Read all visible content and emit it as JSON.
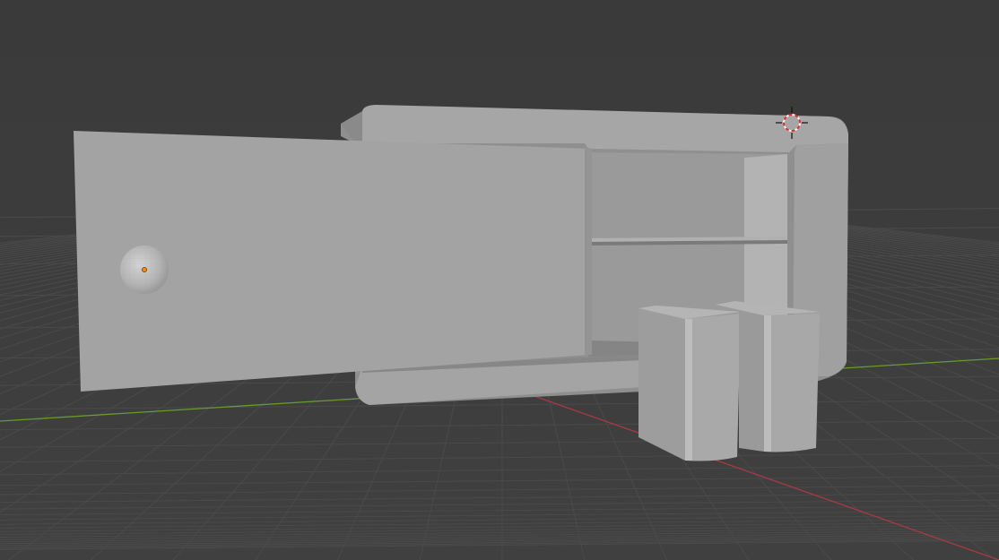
{
  "viewport": {
    "background_color": "#3d3d3d",
    "grid_color": "#4a4a4a",
    "x_axis_color": "#a83a44",
    "y_axis_color": "#6a9a2a"
  },
  "scene": {
    "objects": [
      {
        "name": "cabinet",
        "color": "#9c9c9c"
      },
      {
        "name": "sliding-door",
        "color": "#a3a3a3"
      },
      {
        "name": "door-knob",
        "color": "#c0c0c0"
      },
      {
        "name": "book-left",
        "color": "#a6a6a6"
      },
      {
        "name": "book-right",
        "color": "#a6a6a6"
      }
    ],
    "origin_dot_color": "#ff8a00",
    "cursor_icon": "3d-cursor-icon"
  }
}
